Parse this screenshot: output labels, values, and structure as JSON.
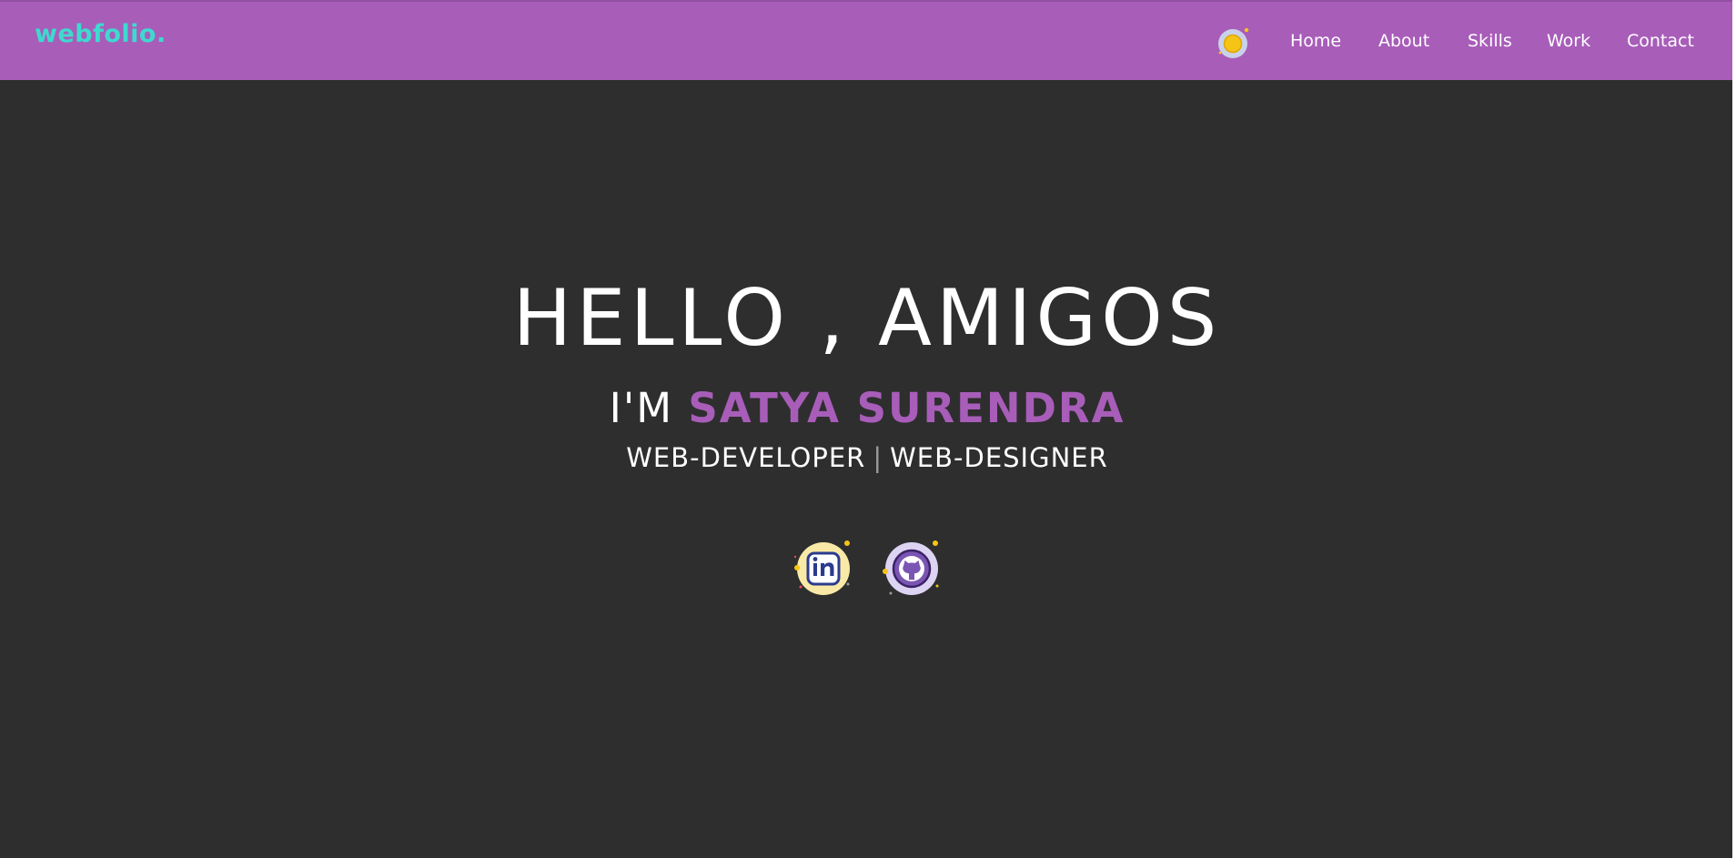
{
  "navbar": {
    "logo": "webfolio.",
    "theme_toggle_icon": "sun-icon",
    "links": [
      {
        "label": "Home"
      },
      {
        "label": "About"
      },
      {
        "label": "Skills"
      },
      {
        "label": "Work"
      },
      {
        "label": "Contact"
      }
    ]
  },
  "hero": {
    "greeting": "HELLO , AMIGOS",
    "intro_prefix": "I'M",
    "name": "SATYA SURENDRA",
    "role_one": "WEB-DEVELOPER",
    "separator": "|",
    "role_two": "WEB-DESIGNER"
  },
  "social": [
    {
      "icon": "linkedin-icon"
    },
    {
      "icon": "github-icon"
    }
  ],
  "colors": {
    "navbar_bg": "#a85db9",
    "page_bg": "#2e2e2e",
    "logo": "#3fd9cf",
    "accent": "#a85db9",
    "text": "#ffffff"
  }
}
